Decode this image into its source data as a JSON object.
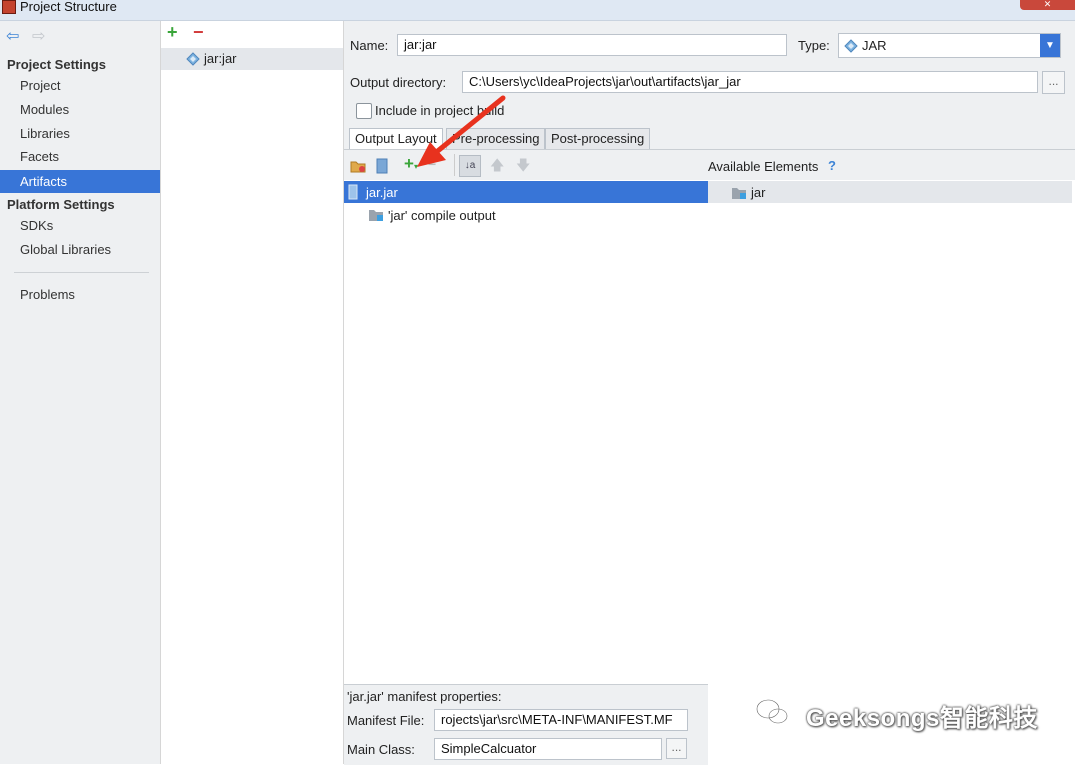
{
  "window": {
    "title": "Project Structure"
  },
  "sidebar": {
    "project_settings_label": "Project Settings",
    "platform_settings_label": "Platform Settings",
    "items": [
      "Project",
      "Modules",
      "Libraries",
      "Facets",
      "Artifacts"
    ],
    "platform_items": [
      "SDKs",
      "Global Libraries"
    ],
    "problems_label": "Problems",
    "selected": "Artifacts"
  },
  "artifacts": {
    "add": "+",
    "remove": "−",
    "items": [
      "jar:jar"
    ]
  },
  "form": {
    "name_label": "Name:",
    "name_value": "jar:jar",
    "type_label": "Type:",
    "type_value": "JAR",
    "output_dir_label": "Output directory:",
    "output_dir_value": "C:\\Users\\yc\\IdeaProjects\\jar\\out\\artifacts\\jar_jar",
    "browse_label": "...",
    "include_label": "Include in project build",
    "include_checked": false
  },
  "tabs": [
    "Output Layout",
    "Pre-processing",
    "Post-processing"
  ],
  "layout_tree": {
    "root": "jar.jar",
    "children": [
      "'jar' compile output"
    ]
  },
  "available": {
    "label": "Available Elements",
    "help": "?",
    "items": [
      "jar"
    ]
  },
  "manifest": {
    "header": "'jar.jar' manifest properties:",
    "file_label": "Manifest File:",
    "file_value": "rojects\\jar\\src\\META-INF\\MANIFEST.MF",
    "main_class_label": "Main Class:",
    "main_class_value": "SimpleCalcuator",
    "browse_label": "..."
  },
  "watermark": {
    "text": "Geeksongs智能科技"
  },
  "colors": {
    "selection": "#3875d7",
    "add": "#3aa53a",
    "remove": "#d23b3b",
    "annotation": "#e8321e"
  }
}
